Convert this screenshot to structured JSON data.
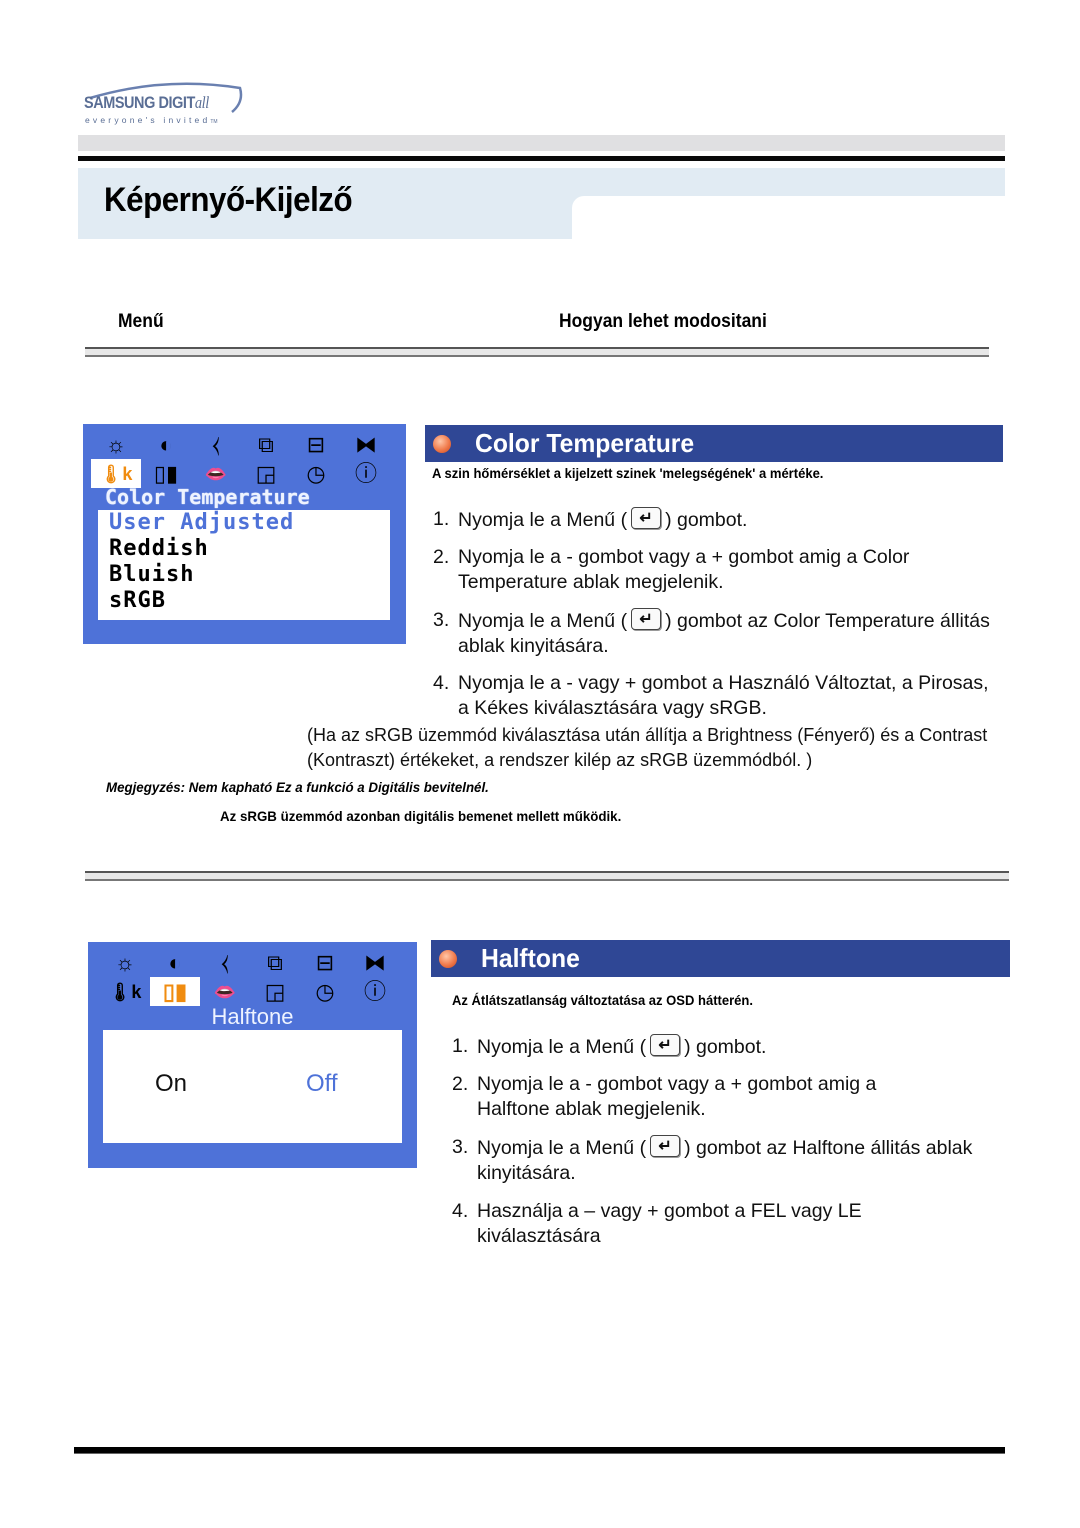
{
  "logo": {
    "brand": "SAMSUNG DIGIT",
    "brand_suffix": "all",
    "tagline": "everyone's invited",
    "tm": "TM"
  },
  "page": {
    "title": "Képernyő-Kijelző"
  },
  "columns": {
    "menu": "Menű",
    "how": "Hogyan lehet modositani"
  },
  "color_temperature": {
    "heading": "Color Temperature",
    "subtitle": "A szin hőmérséklet a kijelzett szinek 'melegségének' a mértéke.",
    "osd": {
      "icons_row1": [
        "brightness-icon",
        "contrast-icon",
        "position-icon",
        "size-icon",
        "image-icon",
        "zoom-icon"
      ],
      "icons_row2": [
        "color-temperature-icon",
        "halftone-icon",
        "language-icon",
        "pip-icon",
        "timer-icon",
        "info-icon"
      ],
      "selected_icon": "color-temperature-icon",
      "heading": "Color Temperature",
      "options": [
        "User Adjusted",
        "Reddish",
        "Bluish",
        "sRGB"
      ],
      "active_option": "User Adjusted"
    },
    "steps": [
      {
        "num": "1.",
        "before": "Nyomja le a Menű (",
        "after": ") gombot."
      },
      {
        "num": "2.",
        "text": "Nyomja le a - gombot vagy a + gombot amig a Color Temperature ablak megjelenik."
      },
      {
        "num": "3.",
        "before": "Nyomja le a Menű (",
        "after": ") gombot az Color Temperature állitás ablak kinyitására."
      },
      {
        "num": "4.",
        "text": "Nyomja le a - vagy + gombot a Használó Változtat, a Pirosas, a Kékes kiválasztására vagy sRGB."
      }
    ],
    "srgb_note": "(Ha az sRGB üzemmód kiválasztása után állítja a Brightness (Fényerő) és a Contrast (Kontraszt) értékeket, a rendszer kilép az sRGB üzemmódból. )",
    "remark": "Megjegyzés: Nem kapható Ez a funkció a Digitális bevitelnél.",
    "remark2": "Az sRGB üzemmód azonban digitális bemenet mellett működik."
  },
  "halftone": {
    "heading": "Halftone",
    "subtitle": "Az Átlátszatlanság változtatása az OSD hátterén.",
    "osd": {
      "selected_icon": "halftone-icon",
      "heading": "Halftone",
      "options": [
        "On",
        "Off"
      ],
      "active_option": "Off"
    },
    "steps": [
      {
        "num": "1.",
        "before": "Nyomja le a Menű (",
        "after": ") gombot."
      },
      {
        "num": "2.",
        "text": "Nyomja le a - gombot vagy a + gombot amig a Halftone ablak megjelenik."
      },
      {
        "num": "3.",
        "before": "Nyomja le a Menű (",
        "after": ") gombot az Halftone állitás ablak kinyitására."
      },
      {
        "num": "4.",
        "text": "Használja a – vagy + gombot a FEL vagy LE kiválasztására"
      }
    ]
  },
  "colors": {
    "osd_blue": "#4e72d8",
    "heading_blue": "#2f4795",
    "title_band": "#e1ebf3",
    "selected_orange": "#f08c10"
  }
}
